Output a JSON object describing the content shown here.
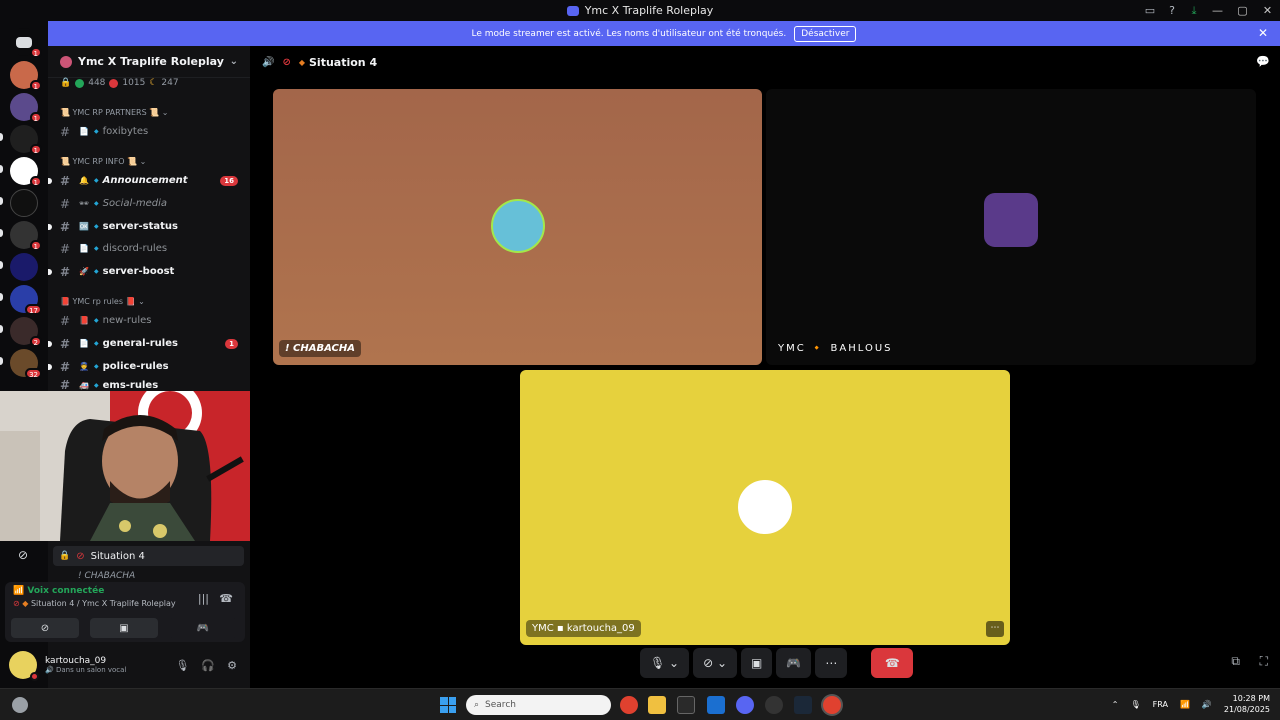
{
  "window": {
    "title": "Ymc X Traplife Roleplay"
  },
  "banner": {
    "text": "Le mode streamer est activé. Les noms d'utilisateur ont été tronqués.",
    "button": "Désactiver"
  },
  "guild_badges": [
    "1",
    "1",
    "1",
    "1",
    "1",
    "1",
    "17",
    "2",
    "32",
    "1"
  ],
  "server": {
    "name": "Ymc X Traplife Roleplay",
    "online": "448",
    "dnd": "1015",
    "idle": "247"
  },
  "categories": [
    "YMC RP PARTNERS",
    "YMC RP INFO",
    "YMC rp rules"
  ],
  "channels": [
    {
      "name": "foxibytes",
      "unread": false,
      "count": "",
      "emoji": "📄"
    },
    {
      "name": "Announcement",
      "unread": true,
      "count": "16",
      "emoji": "🔔"
    },
    {
      "name": "Social-media",
      "unread": false,
      "count": "",
      "emoji": "🕶"
    },
    {
      "name": "server-status",
      "unread": true,
      "count": "",
      "emoji": "🆗"
    },
    {
      "name": "discord-rules",
      "unread": false,
      "count": "",
      "emoji": "📄"
    },
    {
      "name": "server-boost",
      "unread": true,
      "count": "",
      "emoji": "🚀"
    },
    {
      "name": "new-rules",
      "unread": false,
      "count": "",
      "emoji": "📕"
    },
    {
      "name": "general-rules",
      "unread": true,
      "count": "1",
      "emoji": "📄"
    },
    {
      "name": "police-rules",
      "unread": true,
      "count": "",
      "emoji": "👮"
    },
    {
      "name": "ems-rules",
      "unread": true,
      "count": "",
      "emoji": "🚑"
    }
  ],
  "voice_channel": {
    "name": "Situation 4",
    "member": "! CHABACHA"
  },
  "voice_panel": {
    "status": "Voix connectée",
    "location": "Situation 4 / Ymc X Traplife Roleplay"
  },
  "user": {
    "name": "kartoucha_09",
    "status": "Dans un salon vocal"
  },
  "stage": {
    "title": "Situation 4"
  },
  "tiles": [
    {
      "label": "! CHABACHA",
      "color": "#a7694a"
    },
    {
      "label": "YMC 🔸 BAHLOUS",
      "color": "#0a0a0a"
    },
    {
      "label": "YMC ▪ kartoucha_09",
      "color": "#e6d13d"
    }
  ],
  "taskbar": {
    "search": "Search",
    "lang": "FRA",
    "time": "10:28 PM",
    "date": "21/08/2025"
  }
}
